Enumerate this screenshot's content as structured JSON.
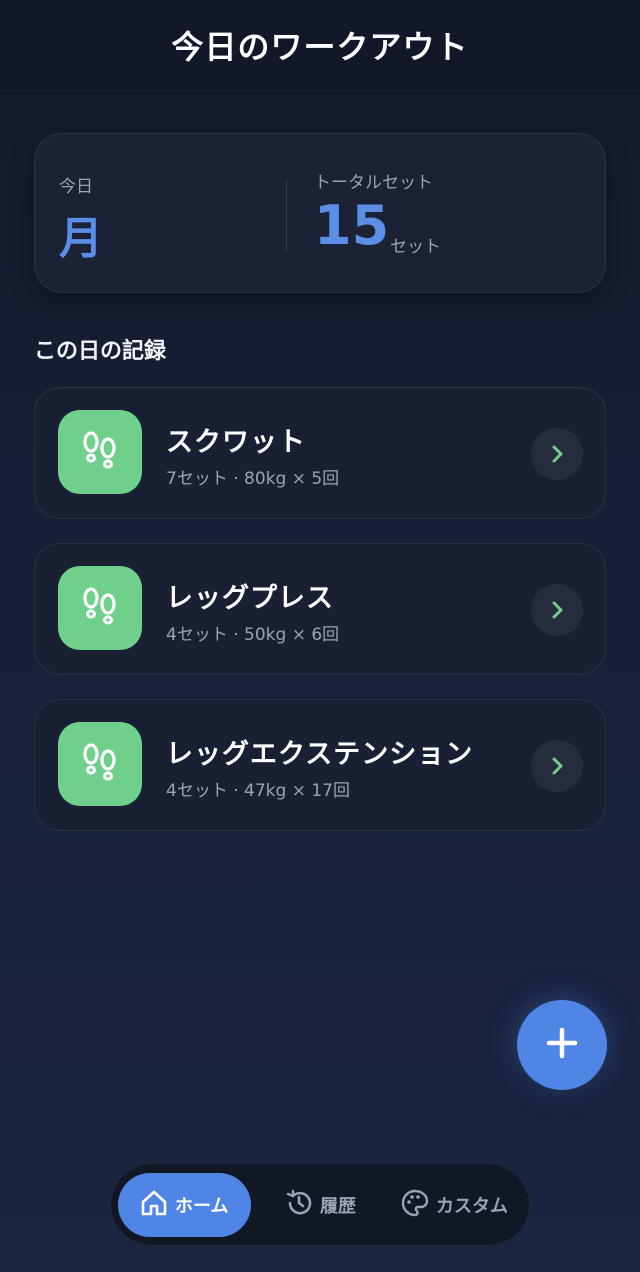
{
  "header": {
    "title": "今日のワークアウト"
  },
  "summary": {
    "today_label": "今日",
    "today_value": "月",
    "total_label": "トータルセット",
    "total_value": "15",
    "total_unit": "セット"
  },
  "section": {
    "title": "この日の記録"
  },
  "exercises": [
    {
      "name": "スクワット",
      "detail": "7セット · 80kg × 5回",
      "icon": "footprints-icon"
    },
    {
      "name": "レッグプレス",
      "detail": "4セット · 50kg × 6回",
      "icon": "footprints-icon"
    },
    {
      "name": "レッグエクステンション",
      "detail": "4セット · 47kg × 17回",
      "icon": "footprints-icon"
    }
  ],
  "fab": {
    "icon": "plus-icon"
  },
  "nav": {
    "items": [
      {
        "label": "ホーム",
        "icon": "home-icon",
        "active": true
      },
      {
        "label": "履歴",
        "icon": "history-icon",
        "active": false
      },
      {
        "label": "カスタム",
        "icon": "palette-icon",
        "active": false
      }
    ]
  },
  "colors": {
    "accent": "#4f86e6",
    "big_number": "#5b8ee6",
    "exercise_icon_bg": "#6fd08c",
    "chevron": "#6fd08c"
  }
}
